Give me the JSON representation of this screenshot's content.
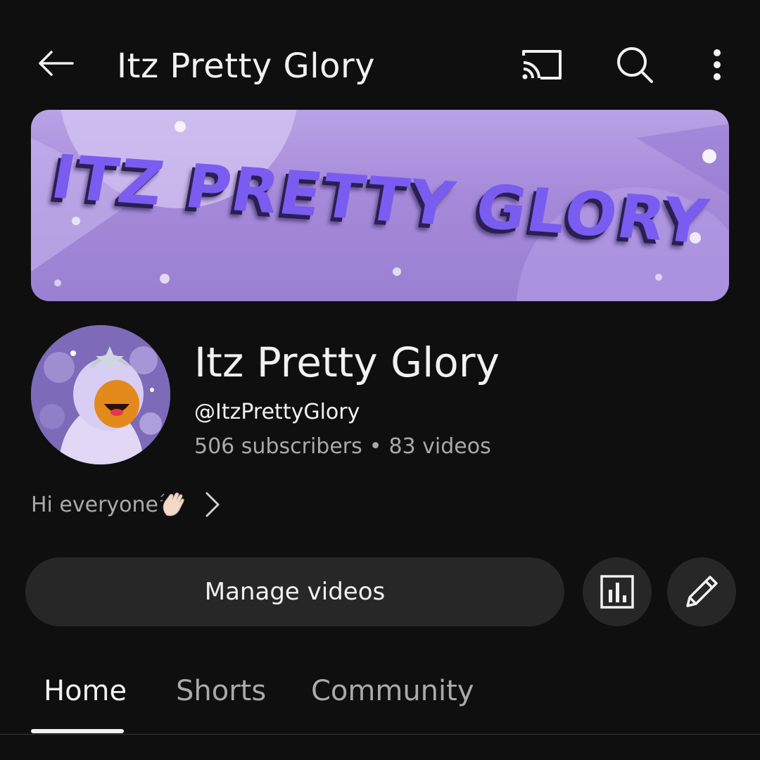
{
  "header": {
    "title": "Itz Pretty Glory",
    "icons": [
      "back-arrow-icon",
      "cast-icon",
      "search-icon",
      "more-vert-icon"
    ]
  },
  "banner": {
    "text": "ITZ PRETTY GLORY"
  },
  "channel": {
    "name": "Itz Pretty Glory",
    "handle": "@ItzPrettyGlory",
    "subscribers": "506 subscribers",
    "separator": "•",
    "videos": "83 videos",
    "description": "Hi everyone"
  },
  "actions": {
    "manage_label": "Manage videos",
    "icons": [
      "analytics-icon",
      "edit-pencil-icon"
    ]
  },
  "tabs": [
    {
      "label": "Home",
      "active": true
    },
    {
      "label": "Shorts",
      "active": false
    },
    {
      "label": "Community",
      "active": false
    }
  ],
  "colors": {
    "background": "#0f0f0f",
    "text_primary": "#f1f1f1",
    "text_secondary": "#aaaaaa",
    "button_bg": "#272727",
    "banner_purple": "#a58ad9",
    "banner_text": "#7b5cf0"
  }
}
